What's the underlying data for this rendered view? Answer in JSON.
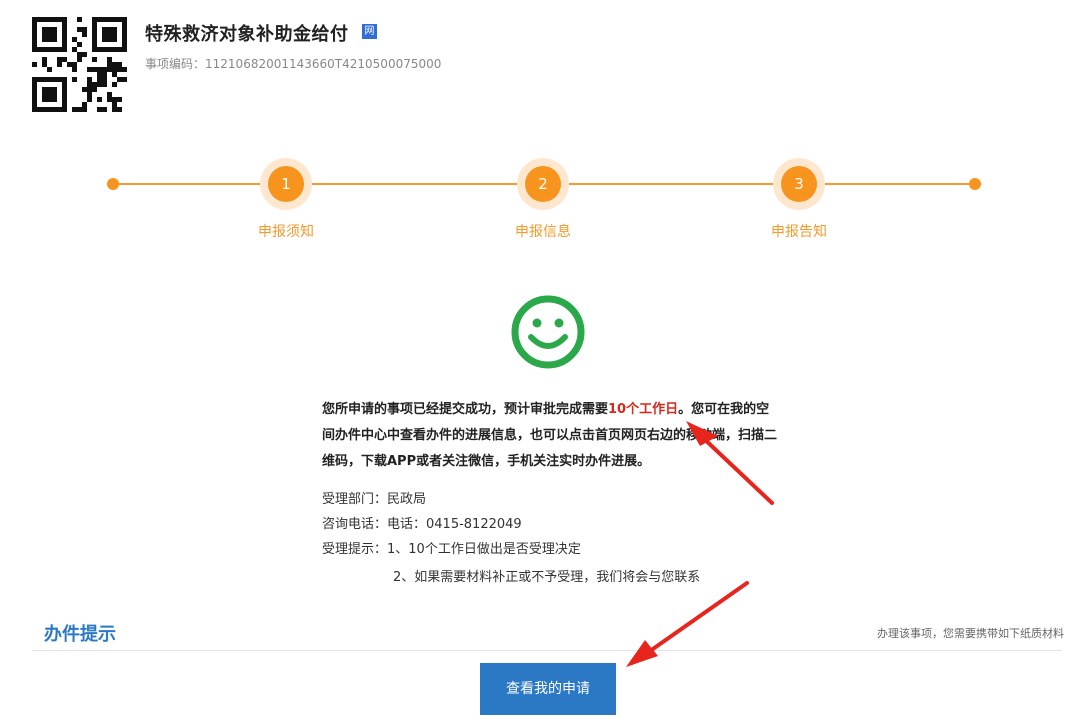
{
  "header": {
    "title": "特殊救济对象补助金给付",
    "badge_icon": "net-badge-icon",
    "badge_text": "网",
    "code_label": "事项编码：",
    "code_value": "11210682001143660T4210500075000"
  },
  "steps": [
    {
      "number": "1",
      "label": "申报须知"
    },
    {
      "number": "2",
      "label": "申报信息"
    },
    {
      "number": "3",
      "label": "申报告知"
    }
  ],
  "status_icon": "smiley-icon",
  "message": {
    "part1": "您所申请的事项已经提交成功，预计审批完成需要",
    "highlight": "10个工作日",
    "part2": "。您可在我的空间办件中心中查看办件的进展信息，也可以点击首页网页右边的移动端，扫描二维码，下载APP或者关注微信，手机关注实时办件进展。"
  },
  "info": {
    "dept": "受理部门：民政局",
    "phone": "咨询电话：电话：0415-8122049",
    "tip1": "受理提示：1、10个工作日做出是否受理决定",
    "tip2": "2、如果需要材料补正或不予受理，我们将会与您联系"
  },
  "section": {
    "title": "办件提示",
    "note": "办理该事项，您需要携带如下纸质材料"
  },
  "button": {
    "label": "查看我的申请"
  },
  "colors": {
    "orange": "#f7941d",
    "blue": "#2b78c5",
    "green": "#2aa84a",
    "red": "#d6281d"
  }
}
